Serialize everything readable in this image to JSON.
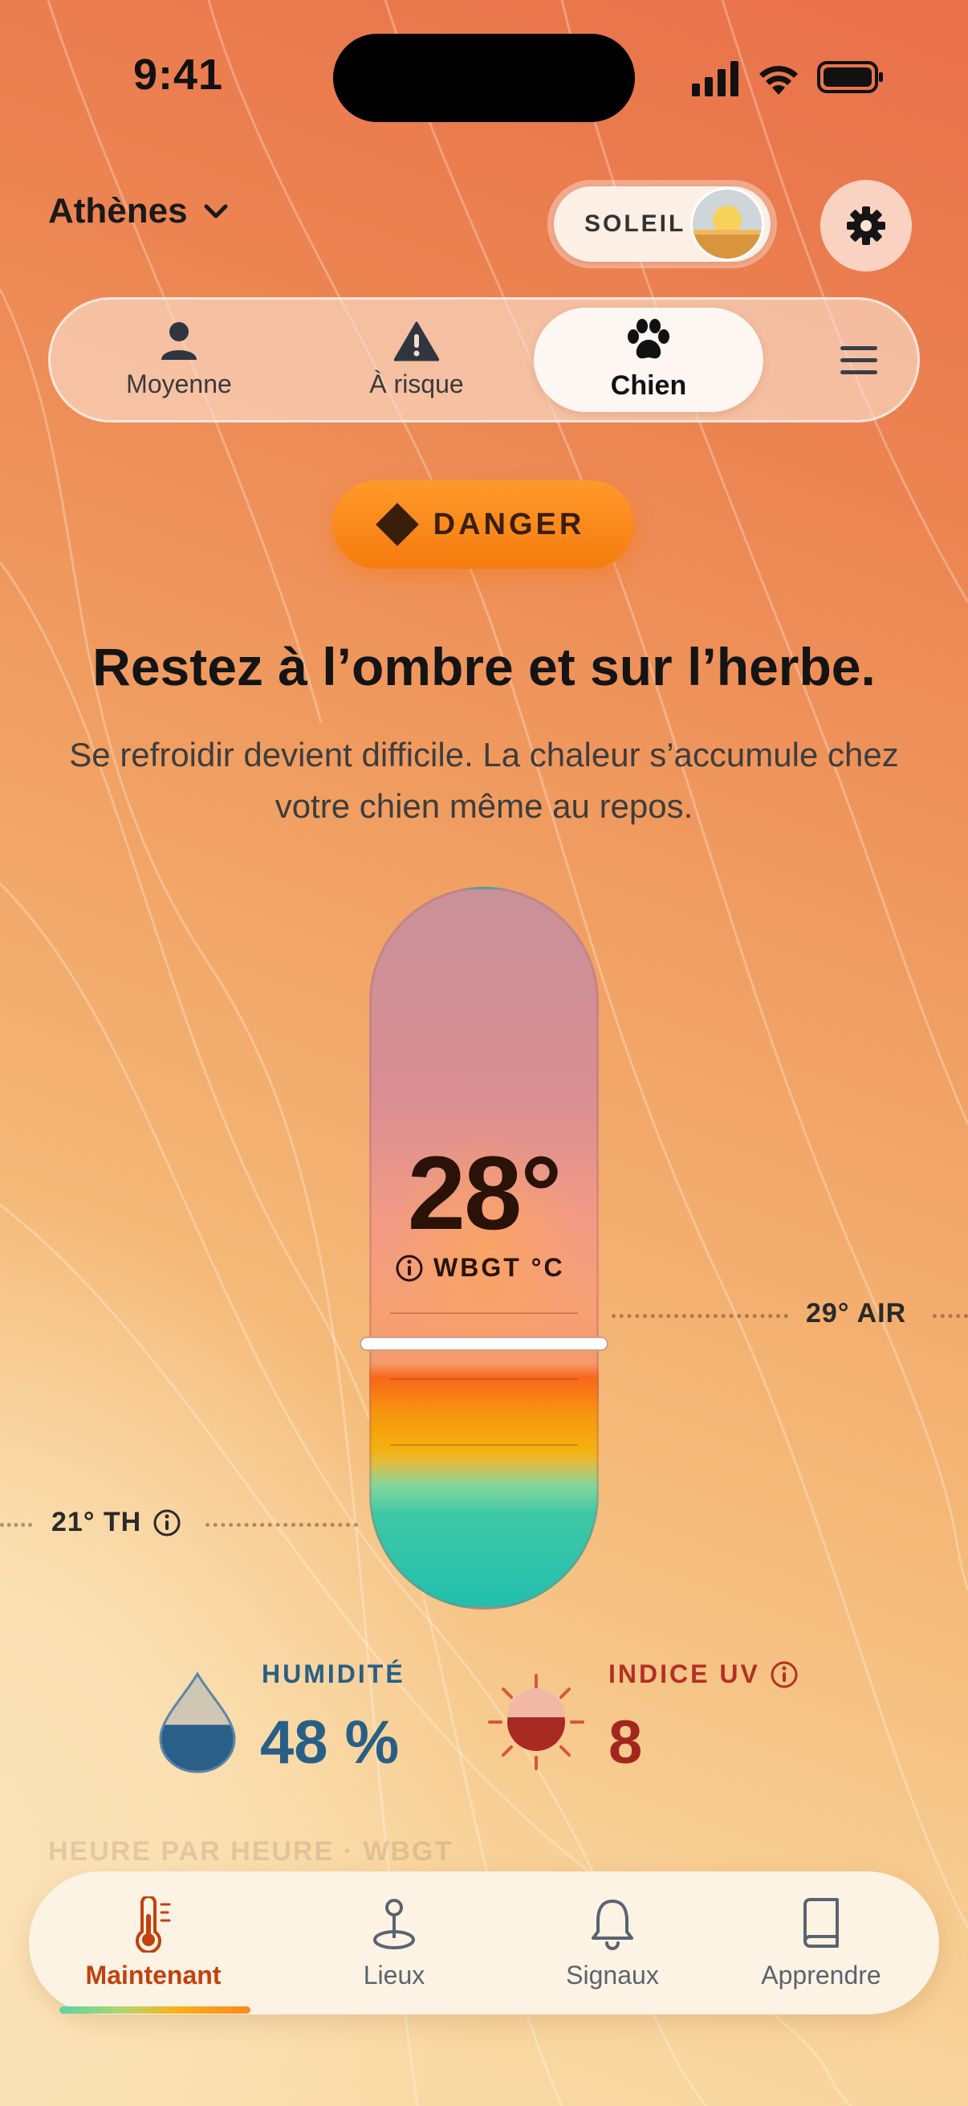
{
  "status_bar": {
    "time": "9:41"
  },
  "header": {
    "city": "Athènes",
    "sun_toggle_label": "SOLEIL"
  },
  "segments": [
    {
      "label": "Moyenne",
      "icon": "person-icon",
      "active": false
    },
    {
      "label": "À risque",
      "icon": "warning-icon",
      "active": false
    },
    {
      "label": "Chien",
      "icon": "paw-icon",
      "active": true
    }
  ],
  "alert": {
    "level": "DANGER",
    "headline": "Restez à l’ombre et sur l’herbe.",
    "description": "Se refroidir devient difficile. La chaleur s’accumule chez votre chien même au repos."
  },
  "gauge": {
    "wbgt_value": "28°",
    "wbgt_unit": "WBGT °C",
    "air_label": "29° AIR",
    "th_label": "21° TH"
  },
  "stats": {
    "humidity": {
      "title": "HUMIDITÉ",
      "value": "48 %",
      "fill": 0.48
    },
    "uv": {
      "title": "INDICE UV",
      "value": "8"
    }
  },
  "faded_section_title": "HEURE PAR HEURE · WBGT",
  "tabbar": [
    {
      "label": "Maintenant",
      "icon": "thermometer-icon",
      "active": true
    },
    {
      "label": "Lieux",
      "icon": "map-pin-icon",
      "active": false
    },
    {
      "label": "Signaux",
      "icon": "bell-icon",
      "active": false
    },
    {
      "label": "Apprendre",
      "icon": "book-icon",
      "active": false
    }
  ],
  "colors": {
    "danger": "#f57b0e",
    "humidity": "#275f86",
    "uv": "#a2261e",
    "active_tab": "#c2410c"
  }
}
